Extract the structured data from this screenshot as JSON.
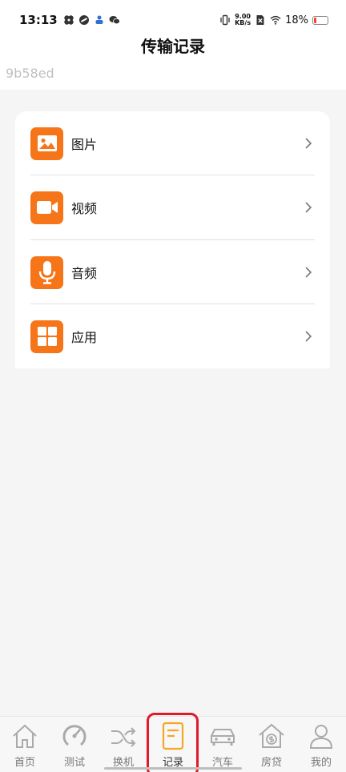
{
  "status_bar": {
    "time": "13:13",
    "net_speed_value": "9.00",
    "net_speed_unit": "KB/s",
    "battery_percent": "18%",
    "battery_level": 0.18,
    "battery_color": "#ff3b30"
  },
  "header": {
    "title": "传输记录",
    "watermark": "9b58ed"
  },
  "accent_color": "#f57518",
  "menu": {
    "items": [
      {
        "label": "图片",
        "icon": "image-icon"
      },
      {
        "label": "视频",
        "icon": "video-camera-icon"
      },
      {
        "label": "音频",
        "icon": "microphone-icon"
      },
      {
        "label": "应用",
        "icon": "apps-grid-icon"
      }
    ]
  },
  "tabbar": {
    "tabs": [
      {
        "label": "首页",
        "icon": "home-icon"
      },
      {
        "label": "测试",
        "icon": "speedometer-icon"
      },
      {
        "label": "换机",
        "icon": "shuffle-icon"
      },
      {
        "label": "记录",
        "icon": "document-icon",
        "active": true
      },
      {
        "label": "汽车",
        "icon": "car-icon"
      },
      {
        "label": "房贷",
        "icon": "house-money-icon"
      },
      {
        "label": "我的",
        "icon": "person-icon"
      }
    ],
    "highlight_color": "#e01a2a"
  }
}
